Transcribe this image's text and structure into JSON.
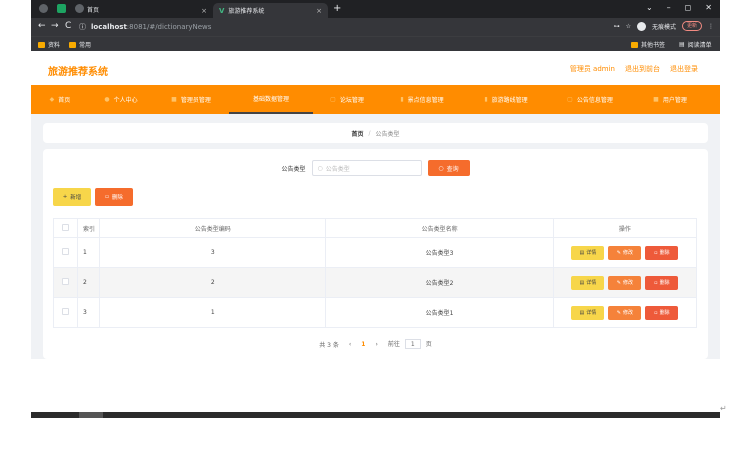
{
  "browser": {
    "tabs": [
      {
        "title": "首页"
      },
      {
        "title": "旅游推荐系统"
      }
    ],
    "url_host": "localhost",
    "url_rest": ":8081/#/dictionaryNews",
    "incognito_label": "无痕模式",
    "update_label": "更新",
    "bookmarks": [
      "资料",
      "常用"
    ],
    "bookmarks_right": [
      "其他书签",
      "阅读清单"
    ]
  },
  "app": {
    "title": "旅游推荐系统",
    "user_links": [
      "管理员 admin",
      "退出到前台",
      "退出登录"
    ],
    "menu": [
      {
        "label": "首页",
        "icon": "home-icon"
      },
      {
        "label": "个人中心",
        "icon": "user-icon"
      },
      {
        "label": "管理员管理",
        "icon": "admin-icon"
      },
      {
        "label": "基础数据管理",
        "icon": "data-icon"
      },
      {
        "label": "论坛管理",
        "icon": "forum-icon"
      },
      {
        "label": "景点信息管理",
        "icon": "scenic-icon"
      },
      {
        "label": "旅游路线管理",
        "icon": "route-icon"
      },
      {
        "label": "公告信息管理",
        "icon": "notice-icon"
      },
      {
        "label": "用户管理",
        "icon": "users-icon"
      }
    ],
    "breadcrumb": [
      "首页",
      "公告类型"
    ]
  },
  "search": {
    "label": "公告类型",
    "placeholder": "公告类型",
    "button": "查询"
  },
  "actions": {
    "add": "新增",
    "delete": "删除"
  },
  "table": {
    "headers": [
      "索引",
      "公告类型编码",
      "公告类型名称",
      "操作"
    ],
    "rows": [
      {
        "index": "1",
        "code": "3",
        "name": "公告类型3"
      },
      {
        "index": "2",
        "code": "2",
        "name": "公告类型2"
      },
      {
        "index": "3",
        "code": "1",
        "name": "公告类型1"
      }
    ],
    "row_buttons": {
      "detail": "详情",
      "edit": "修改",
      "delete": "删除"
    }
  },
  "pager": {
    "total": "共 3 条",
    "current": "1",
    "goto_label": "前往",
    "goto_value": "1",
    "page_suffix": "页"
  },
  "colors": {
    "accent": "#ff8c00",
    "danger": "#f56c2c",
    "warning": "#f7d64a"
  }
}
